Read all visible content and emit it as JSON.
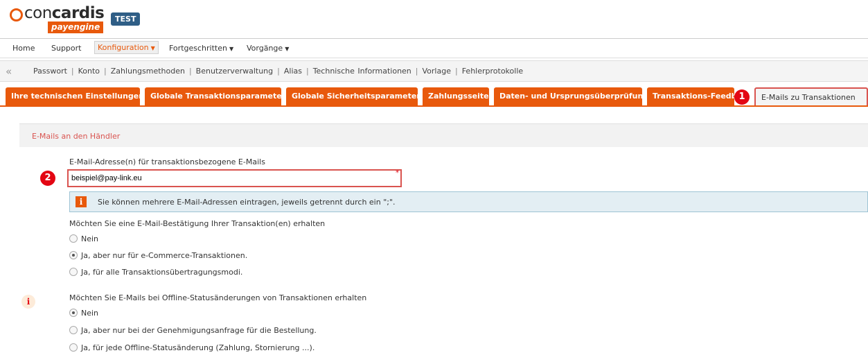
{
  "brand": {
    "logo_text_light": "con",
    "logo_text_bold": "cardis",
    "logo_sub": "payengine",
    "env_badge": "TEST",
    "accent_color": "#e8590c"
  },
  "main_nav": {
    "home": "Home",
    "support": "Support",
    "konfiguration": "Konfiguration",
    "fortgeschritten": "Fortgeschritten",
    "vorgaenge": "Vorgänge"
  },
  "sub_nav": [
    "Passwort",
    "Konto",
    "Zahlungsmethoden",
    "Benutzerverwaltung",
    "Alias",
    "Technische Informationen",
    "Vorlage",
    "Fehlerprotokolle"
  ],
  "tabs": [
    "Ihre technischen Einstellungen",
    "Globale Transaktionsparameter",
    "Globale Sicherheitsparameter",
    "Zahlungsseite",
    "Daten- und Ursprungsüberprüfung",
    "Transaktions-Feedback",
    "E-Mails zu Transaktionen"
  ],
  "markers": {
    "m1": "1",
    "m2": "2"
  },
  "panel": {
    "title": "E-Mails an den Händler",
    "email_label": "E-Mail-Adresse(n) für transaktionsbezogene E-Mails",
    "email_value": "beispiel@pay-link.eu",
    "required_mark": "*",
    "hint_icon": "i",
    "hint_text": "Sie können mehrere E-Mail-Adressen eintragen, jeweils getrennt durch ein \";\".",
    "confirm_question": "Möchten Sie eine E-Mail-Bestätigung Ihrer Transaktion(en) erhalten",
    "confirm_options": [
      "Nein",
      "Ja, aber nur für e-Commerce-Transaktionen.",
      "Ja, für alle Transaktionsübertragungsmodi."
    ],
    "confirm_selected": 1,
    "offline_info_icon": "i",
    "offline_question": "Möchten Sie E-Mails bei Offline-Statusänderungen von Transaktionen erhalten",
    "offline_options": [
      "Nein",
      "Ja, aber nur bei der Genehmigungsanfrage für die Bestellung.",
      "Ja, für jede Offline-Statusänderung (Zahlung, Stornierung ...)."
    ],
    "offline_selected": 0
  }
}
